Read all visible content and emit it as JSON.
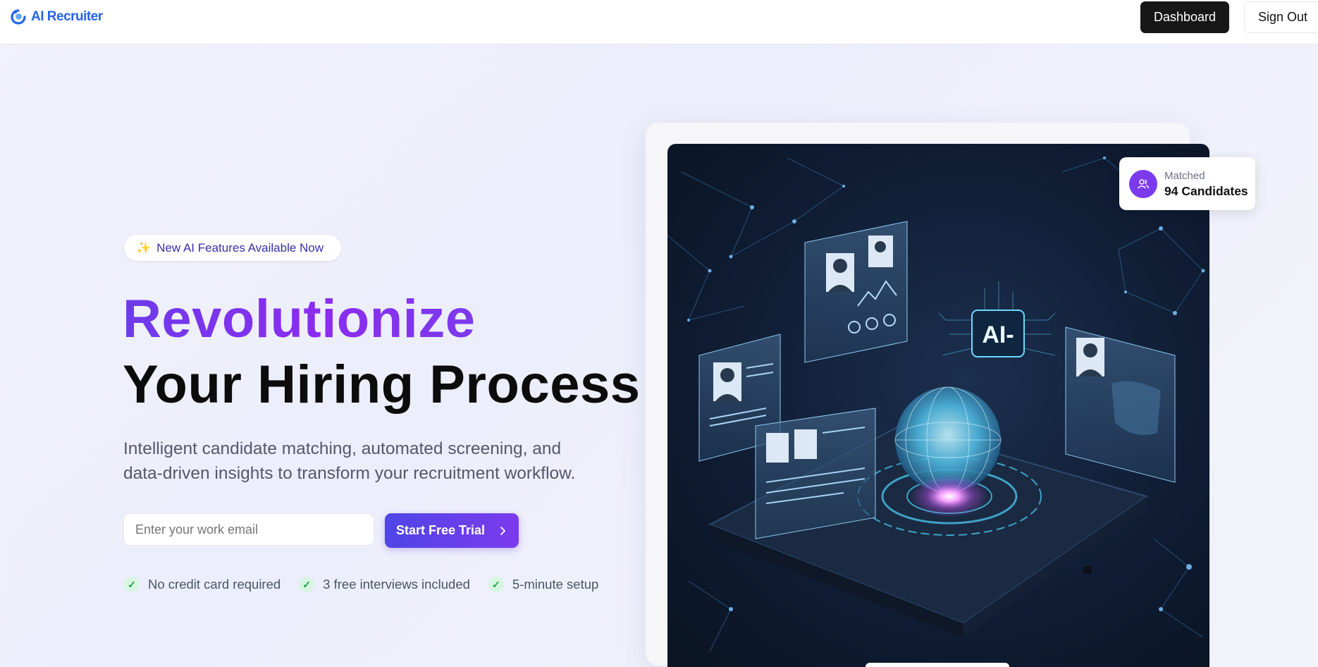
{
  "header": {
    "brand": "AI Recruiter",
    "logo_icon": "logo-swirl-icon",
    "dashboard_label": "Dashboard",
    "signout_label": "Sign Out"
  },
  "hero": {
    "badge_icon": "sparkles-icon",
    "badge_text": "New AI Features Available Now",
    "title_line1": "Revolutionize",
    "title_line2": "Your Hiring Process",
    "subtitle": "Intelligent candidate matching, automated screening, and data-driven insights to transform your recruitment workflow.",
    "email_placeholder": "Enter your work email",
    "cta_label": "Start Free Trial",
    "cta_icon": "chevron-right-icon",
    "features": [
      {
        "icon": "check-icon",
        "label": "No credit card required"
      },
      {
        "icon": "check-icon",
        "label": "3 free interviews included"
      },
      {
        "icon": "check-icon",
        "label": "5-minute setup"
      }
    ]
  },
  "stat_card": {
    "icon": "users-icon",
    "label": "Matched",
    "value": "94 Candidates"
  },
  "colors": {
    "brand_blue": "#2563eb",
    "accent_purple": "#7c3aed",
    "accent_indigo": "#4f46e5",
    "check_green": "#16a34a"
  }
}
